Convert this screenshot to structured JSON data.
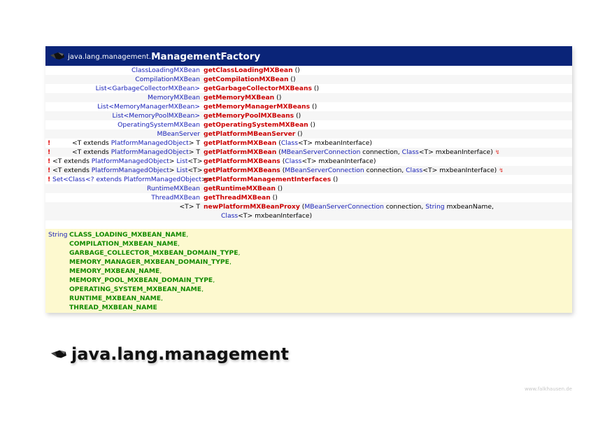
{
  "class_card": {
    "header": {
      "icon": "package-cap-icon",
      "package": "java.lang.management.",
      "class_name": "ManagementFactory"
    },
    "methods": [
      {
        "marker": "",
        "ret_prefix": "",
        "ret_type": "ClassLoadingMXBean",
        "ret_suffix": "",
        "name": "getClassLoadingMXBean",
        "params": "()",
        "throws": false
      },
      {
        "marker": "",
        "ret_prefix": "",
        "ret_type": "CompilationMXBean",
        "ret_suffix": "",
        "name": "getCompilationMXBean",
        "params": "()",
        "throws": false
      },
      {
        "marker": "",
        "ret_prefix": "",
        "ret_type": "List<GarbageCollectorMXBean>",
        "ret_suffix": "",
        "name": "getGarbageCollectorMXBeans",
        "params": "()",
        "throws": false
      },
      {
        "marker": "",
        "ret_prefix": "",
        "ret_type": "MemoryMXBean",
        "ret_suffix": "",
        "name": "getMemoryMXBean",
        "params": "()",
        "throws": false
      },
      {
        "marker": "",
        "ret_prefix": "",
        "ret_type": "List<MemoryManagerMXBean>",
        "ret_suffix": "",
        "name": "getMemoryManagerMXBeans",
        "params": "()",
        "throws": false
      },
      {
        "marker": "",
        "ret_prefix": "",
        "ret_type": "List<MemoryPoolMXBean>",
        "ret_suffix": "",
        "name": "getMemoryPoolMXBeans",
        "params": "()",
        "throws": false
      },
      {
        "marker": "",
        "ret_prefix": "",
        "ret_type": "OperatingSystemMXBean",
        "ret_suffix": "",
        "name": "getOperatingSystemMXBean",
        "params": "()",
        "throws": false
      },
      {
        "marker": "",
        "ret_prefix": "",
        "ret_type": "MBeanServer",
        "ret_suffix": "",
        "name": "getPlatformMBeanServer",
        "params": "()",
        "throws": false
      },
      {
        "marker": "!",
        "ret_prefix": "<T extends ",
        "ret_type": "PlatformManagedObject",
        "ret_suffix": "> T",
        "name": "getPlatformMXBean",
        "params": "(Class<T> mxbeanInterface)",
        "throws": false
      },
      {
        "marker": "!",
        "ret_prefix": "<T extends ",
        "ret_type": "PlatformManagedObject",
        "ret_suffix": "> T",
        "name": "getPlatformMXBean",
        "params": "(MBeanServerConnection connection, Class<T> mxbeanInterface)",
        "throws": true
      },
      {
        "marker": "!",
        "ret_prefix": "<T extends ",
        "ret_type": "PlatformManagedObject",
        "ret_suffix": "> List<T>",
        "name": "getPlatformMXBeans",
        "params": "(Class<T> mxbeanInterface)",
        "throws": false
      },
      {
        "marker": "!",
        "ret_prefix": "<T extends ",
        "ret_type": "PlatformManagedObject",
        "ret_suffix": "> List<T>",
        "name": "getPlatformMXBeans",
        "params": "(MBeanServerConnection connection, Class<T> mxbeanInterface)",
        "throws": true
      },
      {
        "marker": "!",
        "ret_prefix": "Set<Class<? extends ",
        "ret_type": "PlatformManagedObject",
        "ret_suffix": ">>",
        "name": "getPlatformManagementInterfaces",
        "params": "()",
        "throws": false
      },
      {
        "marker": "",
        "ret_prefix": "",
        "ret_type": "RuntimeMXBean",
        "ret_suffix": "",
        "name": "getRuntimeMXBean",
        "params": "()",
        "throws": false
      },
      {
        "marker": "",
        "ret_prefix": "",
        "ret_type": "ThreadMXBean",
        "ret_suffix": "",
        "name": "getThreadMXBean",
        "params": "()",
        "throws": false
      },
      {
        "marker": "",
        "ret_prefix": "<T> T",
        "ret_type": "",
        "ret_suffix": "",
        "name": "newPlatformMXBeanProxy",
        "params": "(MBeanServerConnection connection, String mxbeanName,",
        "params_cont": "Class<T> mxbeanInterface)",
        "throws": true
      }
    ],
    "fields": {
      "type": "String",
      "names": [
        "CLASS_LOADING_MXBEAN_NAME",
        "COMPILATION_MXBEAN_NAME",
        "GARBAGE_COLLECTOR_MXBEAN_DOMAIN_TYPE",
        "MEMORY_MANAGER_MXBEAN_DOMAIN_TYPE",
        "MEMORY_MXBEAN_NAME",
        "MEMORY_POOL_MXBEAN_DOMAIN_TYPE",
        "OPERATING_SYSTEM_MXBEAN_NAME",
        "RUNTIME_MXBEAN_NAME",
        "THREAD_MXBEAN_NAME"
      ]
    }
  },
  "package_title": "java.lang.management",
  "footer": "www.falkhausen.de",
  "colors": {
    "header_bg": "#0a2478",
    "type_blue": "#1a22b8",
    "method_red": "#cc0000",
    "field_green": "#138a00",
    "field_bg": "#fdf9cf"
  }
}
